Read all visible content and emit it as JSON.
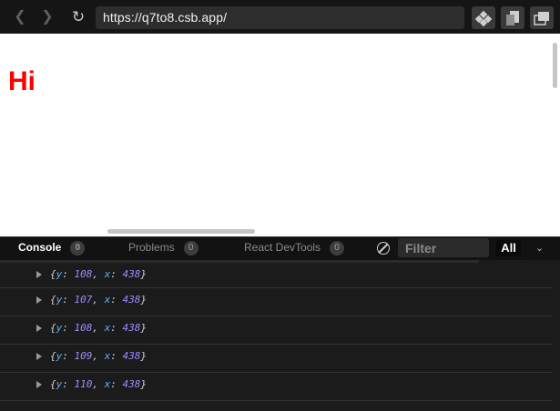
{
  "browser": {
    "url": "https://q7to8.csb.app/",
    "icons": {
      "back": "arrow-left-icon",
      "forward": "arrow-right-icon",
      "reload": "reload-icon"
    }
  },
  "page": {
    "heading": "Hi",
    "heading_color": "#ff0000"
  },
  "devtools": {
    "tabs": [
      {
        "label": "Console",
        "count": "0"
      },
      {
        "label": "Problems",
        "count": "0"
      },
      {
        "label": "React DevTools",
        "count": "0"
      }
    ],
    "filter_placeholder": "Filter",
    "level_selector": "All",
    "logs": [
      {
        "y": "108",
        "x": "438"
      },
      {
        "y": "107",
        "x": "438"
      },
      {
        "y": "108",
        "x": "438"
      },
      {
        "y": "109",
        "x": "438"
      },
      {
        "y": "110",
        "x": "438"
      }
    ]
  }
}
